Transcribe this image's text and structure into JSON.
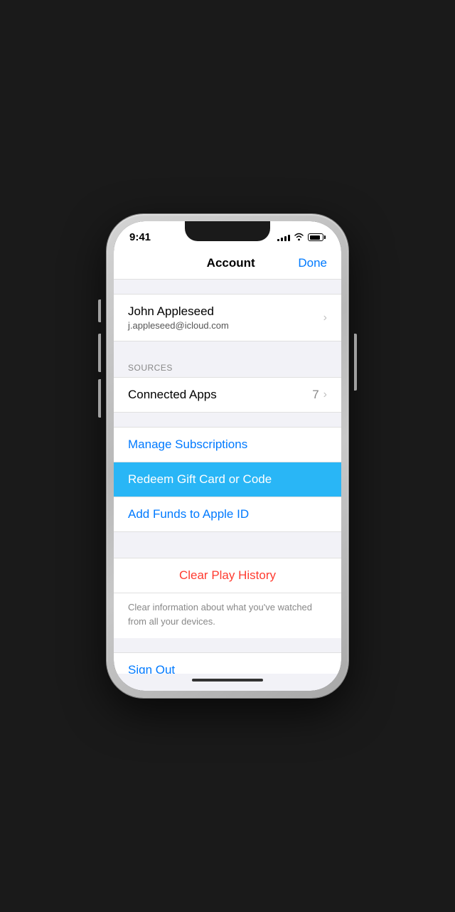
{
  "statusBar": {
    "time": "9:41",
    "signalBars": [
      3,
      5,
      7,
      9,
      11
    ],
    "batteryLevel": 85
  },
  "header": {
    "title": "Account",
    "doneLabel": "Done"
  },
  "userSection": {
    "name": "John Appleseed",
    "email": "j.appleseed@icloud.com"
  },
  "sourcesSection": {
    "headerLabel": "SOURCES",
    "connectedApps": {
      "label": "Connected Apps",
      "count": "7"
    }
  },
  "actions": {
    "manageSubscriptions": "Manage Subscriptions",
    "redeemGiftCard": "Redeem Gift Card or Code",
    "addFunds": "Add Funds to Apple ID"
  },
  "clearHistory": {
    "label": "Clear Play History",
    "description": "Clear information about what you've watched from all your devices."
  },
  "signOut": {
    "label": "Sign Out"
  },
  "colors": {
    "blue": "#007AFF",
    "highlightBg": "#29b6f6",
    "red": "#ff3b30",
    "white": "#ffffff",
    "gray": "#f2f2f7",
    "textPrimary": "#000000",
    "textSecondary": "#888888"
  }
}
